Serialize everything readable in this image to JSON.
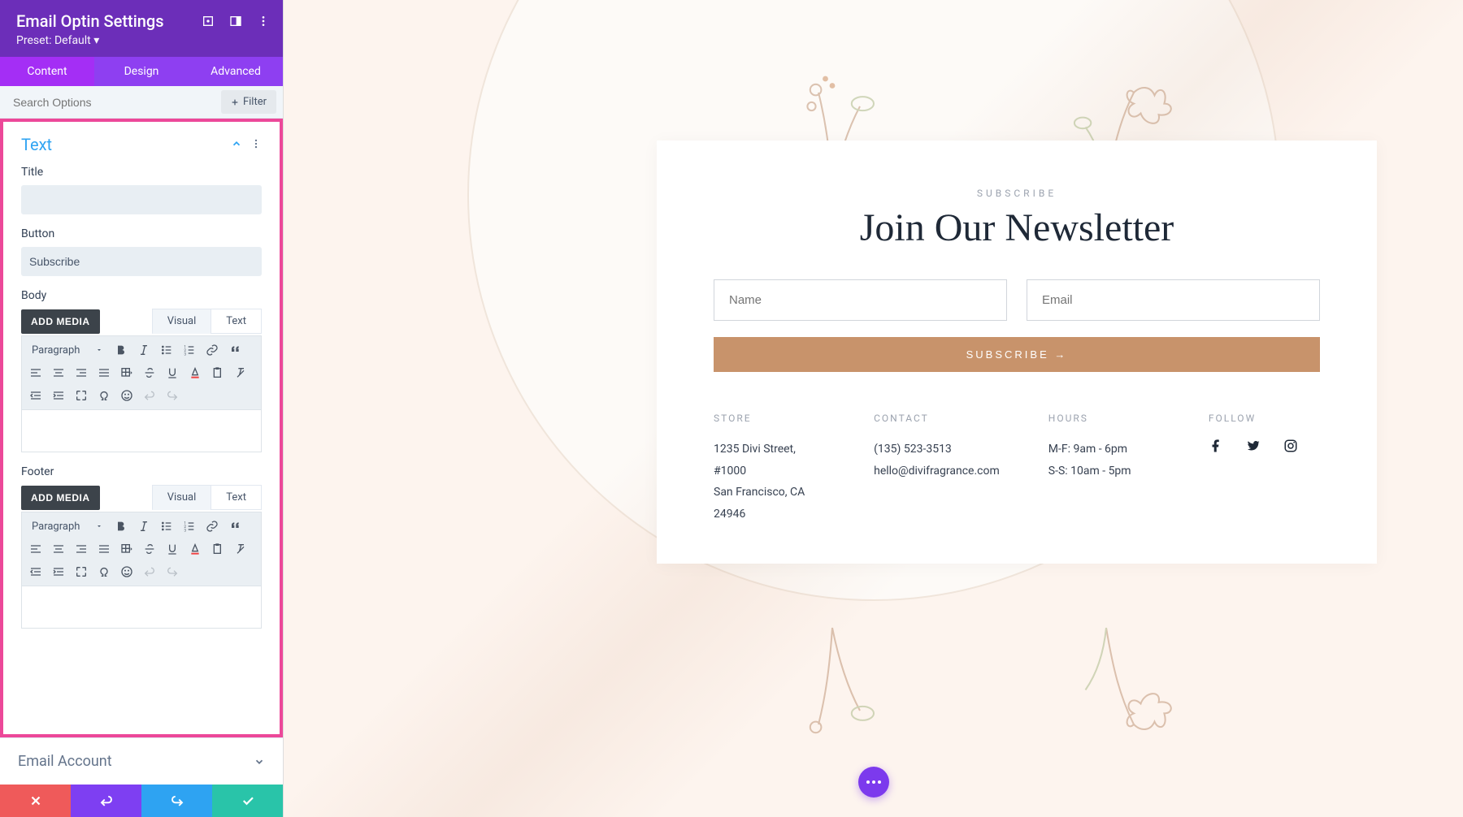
{
  "sidebar": {
    "header": {
      "title": "Email Optin Settings",
      "preset_label": "Preset: Default"
    },
    "tabs": [
      "Content",
      "Design",
      "Advanced"
    ],
    "search_placeholder": "Search Options",
    "filter_label": "Filter",
    "text_section": {
      "title": "Text",
      "fields": {
        "title_label": "Title",
        "title_value": "",
        "button_label": "Button",
        "button_value": "Subscribe",
        "body_label": "Body",
        "footer_label": "Footer"
      },
      "add_media": "ADD MEDIA",
      "mode_visual": "Visual",
      "mode_text": "Text",
      "paragraph_label": "Paragraph"
    },
    "email_section": {
      "title": "Email Account"
    }
  },
  "preview": {
    "subheading": "SUBSCRIBE",
    "heading": "Join Our Newsletter",
    "name_placeholder": "Name",
    "email_placeholder": "Email",
    "subscribe_button": "SUBSCRIBE →",
    "columns": {
      "store": {
        "h": "STORE",
        "lines": [
          "1235 Divi Street, #1000",
          "San Francisco, CA 24946"
        ]
      },
      "contact": {
        "h": "CONTACT",
        "lines": [
          "(135) 523-3513",
          "hello@divifragrance.com"
        ]
      },
      "hours": {
        "h": "HOURS",
        "lines": [
          "M-F: 9am - 6pm",
          "S-S: 10am - 5pm"
        ]
      },
      "follow": {
        "h": "FOLLOW"
      }
    }
  }
}
